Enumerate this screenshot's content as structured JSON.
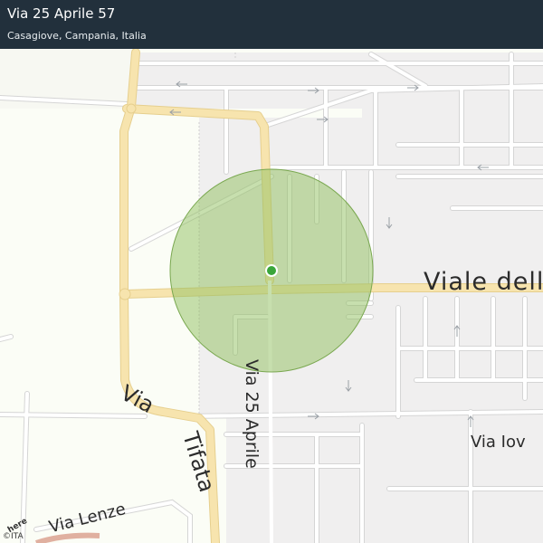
{
  "header": {
    "title": "Via 25 Aprile 57",
    "subtitle": "Casagiove, Campania, Italia"
  },
  "labels": {
    "viale": "Viale dell",
    "via_25_aprile": "Via 25 Aprile",
    "via": "Via",
    "tifata": "Tifata",
    "via_iov": "Via Iov",
    "via_lenze": "Via Lenze"
  },
  "branding": {
    "logo": "here",
    "copyright": "©ITA"
  },
  "colors": {
    "major_road": "#f6e3ae",
    "minor_road": "#ffffff",
    "block": "#f0efef",
    "background": "#fbfdf6",
    "accuracy_circle": "#8fbf5e",
    "marker": "#3aa63a",
    "header": "#22303c"
  }
}
